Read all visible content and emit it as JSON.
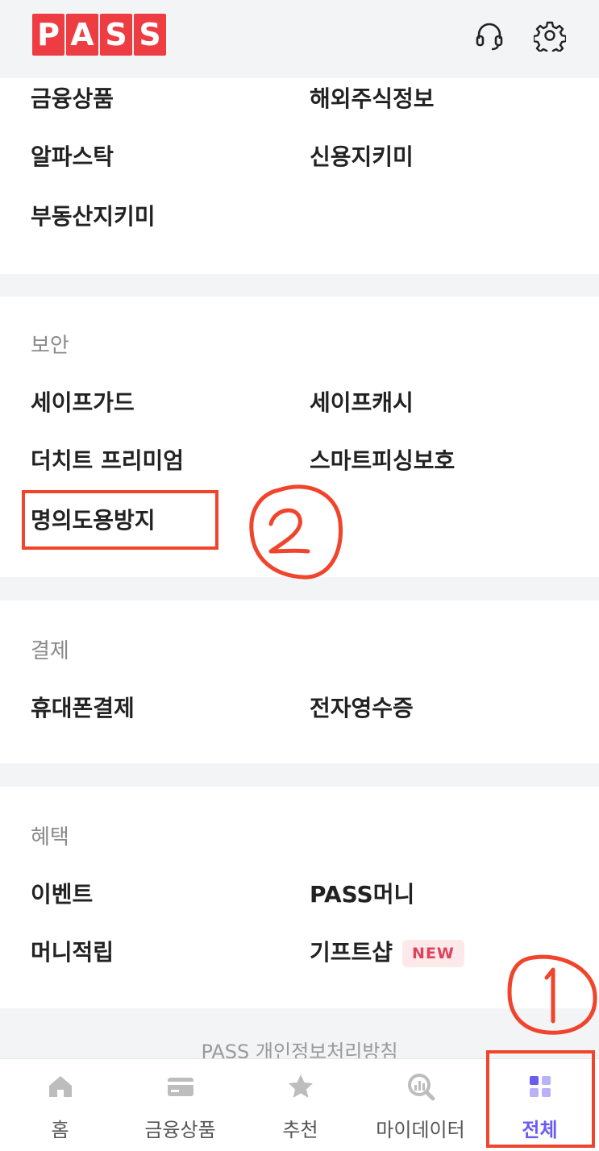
{
  "app": {
    "logo_letters": [
      "P",
      "A",
      "S",
      "S"
    ],
    "brand_color": "#ee3c43",
    "header_icons": [
      "headset-icon",
      "gear-icon"
    ]
  },
  "finance_section": {
    "items": [
      "금융상품",
      "해외주식정보",
      "알파스탁",
      "신용지키미",
      "부동산지키미"
    ]
  },
  "security_section": {
    "title": "보안",
    "items": [
      "세이프가드",
      "세이프캐시",
      "더치트 프리미엄",
      "스마트피싱보호",
      "명의도용방지"
    ]
  },
  "payment_section": {
    "title": "결제",
    "items": [
      "휴대폰결제",
      "전자영수증"
    ]
  },
  "benefit_section": {
    "title": "혜택",
    "items": [
      "이벤트",
      "PASS머니",
      "머니적립",
      "기프트샵"
    ],
    "new_badge": "NEW"
  },
  "footer": {
    "policy_link": "PASS 개인정보처리방침"
  },
  "bottom_nav": {
    "items": [
      {
        "label": "홈",
        "icon": "home-icon"
      },
      {
        "label": "금융상품",
        "icon": "card-icon"
      },
      {
        "label": "추천",
        "icon": "star-icon"
      },
      {
        "label": "마이데이터",
        "icon": "chart-search-icon"
      },
      {
        "label": "전체",
        "icon": "grid-icon"
      }
    ],
    "active_color": "#6a5cf0"
  },
  "annotations": {
    "marker_1": "1",
    "marker_2": "2",
    "color": "#f0442c"
  }
}
